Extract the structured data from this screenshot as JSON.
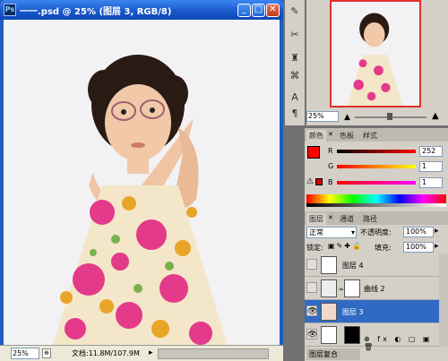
{
  "window": {
    "title": "一一.psd @ 25% (图层 3, RGB/8)",
    "min": "_",
    "max": "□",
    "close": "✕"
  },
  "statusbar": {
    "zoom": "25%",
    "doc_info": "文档:11.8M/107.9M"
  },
  "navigator": {
    "zoom": "25%"
  },
  "color_panel": {
    "tabs": [
      "颜色",
      "色板",
      "样式"
    ],
    "r_label": "R",
    "g_label": "G",
    "b_label": "B",
    "r_value": "252",
    "g_value": "1",
    "b_value": "1",
    "foreground": "#fc0101"
  },
  "layers_panel": {
    "tabs": [
      "图层",
      "通道",
      "路径"
    ],
    "blend_mode": "正常",
    "opacity_label": "不透明度:",
    "opacity_value": "100%",
    "lock_label": "锁定:",
    "fill_label": "填充:",
    "fill_value": "100%",
    "layers": [
      {
        "name": "图层 4",
        "selected": false
      },
      {
        "name": "曲线 2",
        "selected": false
      },
      {
        "name": "图层 3",
        "selected": true
      },
      {
        "name": "",
        "selected": false
      }
    ],
    "bottom_tab": "图层复合"
  },
  "colors": {
    "selection": "#316ac5",
    "title_bar": "#1856c9"
  }
}
